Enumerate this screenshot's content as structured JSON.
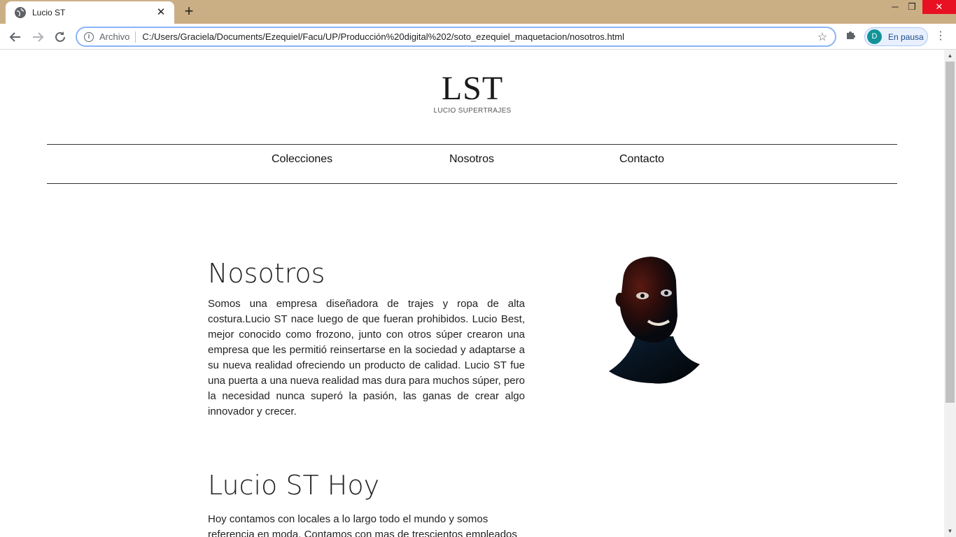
{
  "browser": {
    "tab_title": "Lucio ST",
    "new_tab_symbol": "+",
    "omnibox_prefix": "Archivo",
    "url": "C:/Users/Graciela/Documents/Ezequiel/Facu/UP/Producción%20digital%202/soto_ezequiel_maquetacion/nosotros.html",
    "profile_initial": "D",
    "profile_status": "En pausa",
    "accent": "#cbaf84"
  },
  "header": {
    "logo_text": "LST",
    "logo_subtitle": "LUCIO SUPERTRAJES"
  },
  "nav": {
    "items": [
      {
        "label": "Colecciones"
      },
      {
        "label": "Nosotros"
      },
      {
        "label": "Contacto"
      }
    ]
  },
  "sections": [
    {
      "title": "Nosotros",
      "body": "Somos una empresa diseñadora de trajes y ropa de alta costura.Lucio ST nace luego de que fueran prohibidos. Lucio Best, mejor conocido como frozono, junto con otros súper crearon una empresa que les permitió reinsertarse en la sociedad y adaptarse a su nueva realidad ofreciendo un producto de calidad. Lucio ST fue una puerta a una nueva realidad mas dura para muchos súper, pero la necesidad nunca superó la pasión, las ganas de crear algo innovador y crecer."
    },
    {
      "title": "Lucio ST Hoy",
      "body": "Hoy contamos con locales a lo largo todo el mundo y somos referencia en moda. Contamos con mas de trescientos empleados"
    }
  ]
}
